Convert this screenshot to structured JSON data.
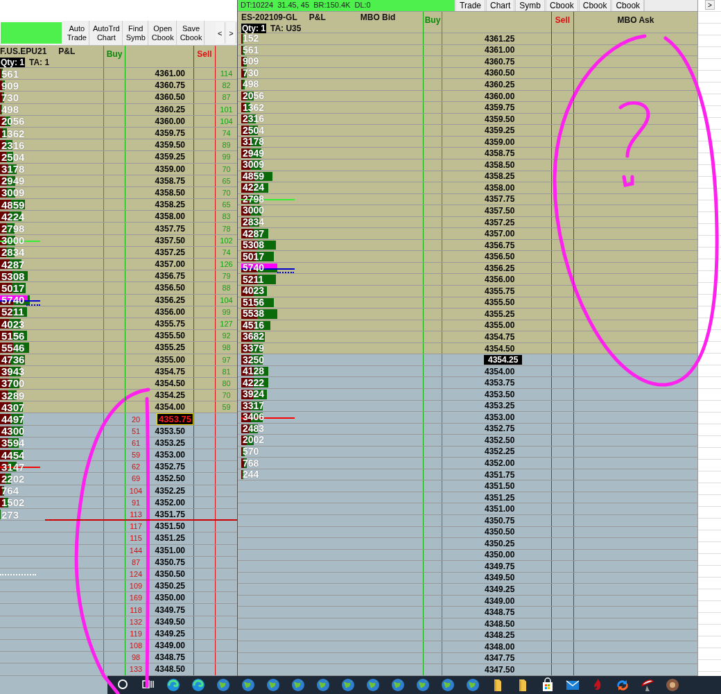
{
  "left_window": {
    "toolbar": {
      "buttons": [
        {
          "label": "Auto Trade"
        },
        {
          "label": "AutoTrd Chart"
        },
        {
          "label": "Find Symb"
        },
        {
          "label": "Open Cbook"
        },
        {
          "label": "Save Cbook"
        }
      ],
      "scroll_buttons": [
        "<",
        ">"
      ]
    },
    "header": {
      "symbol": "F.US.EPU21",
      "columns": [
        "P&L",
        "Buy",
        "Sell"
      ],
      "qty": "Qty: 1",
      "ta": "TA: 1"
    },
    "rows": [
      {
        "price": "4361.00",
        "pl": "561",
        "level": 0.03,
        "ask_qty": "114",
        "above_market": true,
        "current": false
      },
      {
        "price": "4360.75",
        "pl": "909",
        "level": 0.05,
        "ask_qty": "82",
        "above_market": true,
        "current": false
      },
      {
        "price": "4360.50",
        "pl": "730",
        "level": 0.04,
        "ask_qty": "87",
        "above_market": true,
        "current": false
      },
      {
        "price": "4360.25",
        "pl": "498",
        "level": 0.02,
        "ask_qty": "101",
        "above_market": true,
        "current": false
      },
      {
        "price": "4360.00",
        "pl": "2056",
        "level": 0.1,
        "ask_qty": "104",
        "above_market": true,
        "current": false
      },
      {
        "price": "4359.75",
        "pl": "1362",
        "level": 0.07,
        "ask_qty": "74",
        "above_market": true,
        "current": false
      },
      {
        "price": "4359.50",
        "pl": "2316",
        "level": 0.12,
        "ask_qty": "89",
        "above_market": true,
        "current": false
      },
      {
        "price": "4359.25",
        "pl": "2504",
        "level": 0.13,
        "ask_qty": "99",
        "above_market": true,
        "current": false
      },
      {
        "price": "4359.00",
        "pl": "3178",
        "level": 0.16,
        "ask_qty": "70",
        "above_market": true,
        "current": false
      },
      {
        "price": "4358.75",
        "pl": "2949",
        "level": 0.15,
        "ask_qty": "65",
        "above_market": true,
        "current": false
      },
      {
        "price": "4358.50",
        "pl": "3009",
        "level": 0.15,
        "ask_qty": "70",
        "above_market": true,
        "current": false
      },
      {
        "price": "4358.25",
        "pl": "4859",
        "level": 0.24,
        "ask_qty": "65",
        "above_market": true,
        "current": false
      },
      {
        "price": "4358.00",
        "pl": "4224",
        "level": 0.21,
        "ask_qty": "83",
        "above_market": true,
        "current": false
      },
      {
        "price": "4357.75",
        "pl": "2798",
        "level": 0.14,
        "ask_qty": "78",
        "above_market": true,
        "current": false
      },
      {
        "price": "4357.50",
        "pl": "3000",
        "level": 0.15,
        "ask_qty": "102",
        "above_market": true,
        "current": false,
        "markers": [
          {
            "kind": "line",
            "color": "#33ee33"
          }
        ]
      },
      {
        "price": "4357.25",
        "pl": "2834",
        "level": 0.14,
        "ask_qty": "74",
        "above_market": true,
        "current": false
      },
      {
        "price": "4357.00",
        "pl": "4287",
        "level": 0.21,
        "ask_qty": "126",
        "above_market": true,
        "current": false
      },
      {
        "price": "4356.75",
        "pl": "5308",
        "level": 0.27,
        "ask_qty": "79",
        "above_market": true,
        "current": false
      },
      {
        "price": "4356.50",
        "pl": "5017",
        "level": 0.25,
        "ask_qty": "88",
        "above_market": true,
        "current": false
      },
      {
        "price": "4356.25",
        "pl": "5740",
        "level": 0.29,
        "ask_qty": "104",
        "above_market": true,
        "current": false,
        "markers": [
          {
            "kind": "bar",
            "color": "#ff00ff"
          },
          {
            "kind": "line",
            "color": "#0000cc"
          },
          {
            "kind": "short-dotted",
            "color": "#0000cc"
          }
        ]
      },
      {
        "price": "4356.00",
        "pl": "5211",
        "level": 0.26,
        "ask_qty": "99",
        "above_market": true,
        "current": false
      },
      {
        "price": "4355.75",
        "pl": "4023",
        "level": 0.2,
        "ask_qty": "127",
        "above_market": true,
        "current": false
      },
      {
        "price": "4355.50",
        "pl": "5156",
        "level": 0.26,
        "ask_qty": "92",
        "above_market": true,
        "current": false
      },
      {
        "price": "4355.25",
        "pl": "5546",
        "level": 0.28,
        "ask_qty": "98",
        "above_market": true,
        "current": false
      },
      {
        "price": "4355.00",
        "pl": "4736",
        "level": 0.24,
        "ask_qty": "97",
        "above_market": true,
        "current": false
      },
      {
        "price": "4354.75",
        "pl": "3943",
        "level": 0.2,
        "ask_qty": "81",
        "above_market": true,
        "current": false
      },
      {
        "price": "4354.50",
        "pl": "3700",
        "level": 0.19,
        "ask_qty": "80",
        "above_market": true,
        "current": false
      },
      {
        "price": "4354.25",
        "pl": "3289",
        "level": 0.16,
        "ask_qty": "70",
        "above_market": true,
        "current": false
      },
      {
        "price": "4354.00",
        "pl": "4307",
        "level": 0.22,
        "ask_qty": "59",
        "above_market": true,
        "current": false
      },
      {
        "price": "4353.75",
        "pl": "4497",
        "level": 0.22,
        "bid_qty": "20",
        "above_market": false,
        "current": true
      },
      {
        "price": "4353.50",
        "pl": "4300",
        "level": 0.22,
        "bid_qty": "51",
        "above_market": false,
        "current": false
      },
      {
        "price": "4353.25",
        "pl": "3594",
        "level": 0.18,
        "bid_qty": "61",
        "above_market": false,
        "current": false
      },
      {
        "price": "4353.00",
        "pl": "4454",
        "level": 0.22,
        "bid_qty": "59",
        "above_market": false,
        "current": false
      },
      {
        "price": "4352.75",
        "pl": "3147",
        "level": 0.16,
        "bid_qty": "62",
        "above_market": false,
        "current": false,
        "markers": [
          {
            "kind": "line",
            "color": "#ff0000"
          }
        ]
      },
      {
        "price": "4352.50",
        "pl": "2202",
        "level": 0.11,
        "bid_qty": "69",
        "above_market": false,
        "current": false
      },
      {
        "price": "4352.25",
        "pl": "764",
        "level": 0.04,
        "bid_qty": "104",
        "above_market": false,
        "current": false
      },
      {
        "price": "4352.00",
        "pl": "1502",
        "level": 0.08,
        "bid_qty": "91",
        "above_market": false,
        "current": false
      },
      {
        "price": "4351.75",
        "pl": "273",
        "level": 0.01,
        "bid_qty": "113",
        "above_market": false,
        "current": false
      },
      {
        "price": "4351.50",
        "bid_qty": "117",
        "above_market": false,
        "current": false,
        "markers": [
          {
            "kind": "long",
            "color": "#cc0000"
          }
        ]
      },
      {
        "price": "4351.25",
        "bid_qty": "115",
        "above_market": false,
        "current": false
      },
      {
        "price": "4351.00",
        "bid_qty": "144",
        "above_market": false,
        "current": false
      },
      {
        "price": "4350.75",
        "bid_qty": "87",
        "above_market": false,
        "current": false
      },
      {
        "price": "4350.50",
        "bid_qty": "124",
        "above_market": false,
        "current": false,
        "markers": [
          {
            "kind": "dotted",
            "color": "#ffffff"
          }
        ]
      },
      {
        "price": "4350.25",
        "bid_qty": "109",
        "above_market": false,
        "current": false
      },
      {
        "price": "4350.00",
        "bid_qty": "169",
        "above_market": false,
        "current": false
      },
      {
        "price": "4349.75",
        "bid_qty": "118",
        "above_market": false,
        "current": false
      },
      {
        "price": "4349.50",
        "bid_qty": "132",
        "above_market": false,
        "current": false
      },
      {
        "price": "4349.25",
        "bid_qty": "119",
        "above_market": false,
        "current": false
      },
      {
        "price": "4349.00",
        "bid_qty": "108",
        "above_market": false,
        "current": false
      },
      {
        "price": "4348.75",
        "bid_qty": "98",
        "above_market": false,
        "current": false
      },
      {
        "price": "4348.50",
        "bid_qty": "133",
        "above_market": false,
        "current": false
      }
    ]
  },
  "right_window": {
    "status_text": "DT:10224  31.45, 45  BR:150.4K  DL:0",
    "toolbar": {
      "buttons": [
        {
          "label": "Trade"
        },
        {
          "label": "Chart"
        },
        {
          "label": "Symb"
        },
        {
          "label": "Cbook"
        },
        {
          "label": "Cbook"
        },
        {
          "label": "Cbook"
        }
      ]
    },
    "header": {
      "symbol": "ES-202109-GL",
      "columns": [
        "P&L",
        "MBO Bid",
        "Buy",
        "Sell",
        "MBO Ask"
      ],
      "qty": "Qty: 1",
      "ta": "TA: U35"
    },
    "rows": [
      {
        "price": "4361.25",
        "pl": "152",
        "level": 0.01,
        "above_market": true,
        "current": false
      },
      {
        "price": "4361.00",
        "pl": "561",
        "level": 0.02,
        "above_market": true,
        "current": false
      },
      {
        "price": "4360.75",
        "pl": "909",
        "level": 0.03,
        "above_market": true,
        "current": false
      },
      {
        "price": "4360.50",
        "pl": "730",
        "level": 0.03,
        "above_market": true,
        "current": false
      },
      {
        "price": "4360.25",
        "pl": "498",
        "level": 0.02,
        "above_market": true,
        "current": false
      },
      {
        "price": "4360.00",
        "pl": "2056",
        "level": 0.07,
        "above_market": true,
        "current": false
      },
      {
        "price": "4359.75",
        "pl": "1362",
        "level": 0.05,
        "above_market": true,
        "current": false
      },
      {
        "price": "4359.50",
        "pl": "2316",
        "level": 0.08,
        "above_market": true,
        "current": false
      },
      {
        "price": "4359.25",
        "pl": "2504",
        "level": 0.09,
        "above_market": true,
        "current": false
      },
      {
        "price": "4359.00",
        "pl": "3178",
        "level": 0.11,
        "above_market": true,
        "current": false
      },
      {
        "price": "4358.75",
        "pl": "2949",
        "level": 0.11,
        "above_market": true,
        "current": false
      },
      {
        "price": "4358.50",
        "pl": "3009",
        "level": 0.11,
        "above_market": true,
        "current": false
      },
      {
        "price": "4358.25",
        "pl": "4859",
        "level": 0.17,
        "above_market": true,
        "current": false
      },
      {
        "price": "4358.00",
        "pl": "4224",
        "level": 0.15,
        "above_market": true,
        "current": false
      },
      {
        "price": "4357.75",
        "pl": "2798",
        "level": 0.1,
        "above_market": true,
        "current": false,
        "markers": [
          {
            "kind": "line",
            "color": "#33ee33"
          }
        ]
      },
      {
        "price": "4357.50",
        "pl": "3000",
        "level": 0.11,
        "above_market": true,
        "current": false
      },
      {
        "price": "4357.25",
        "pl": "2834",
        "level": 0.1,
        "above_market": true,
        "current": false
      },
      {
        "price": "4357.00",
        "pl": "4287",
        "level": 0.15,
        "above_market": true,
        "current": false
      },
      {
        "price": "4356.75",
        "pl": "5308",
        "level": 0.19,
        "above_market": true,
        "current": false
      },
      {
        "price": "4356.50",
        "pl": "5017",
        "level": 0.18,
        "above_market": true,
        "current": false
      },
      {
        "price": "4356.25",
        "pl": "5740",
        "level": 0.2,
        "above_market": true,
        "current": false,
        "markers": [
          {
            "kind": "bar",
            "color": "#ff00ff"
          },
          {
            "kind": "line",
            "color": "#0000cc"
          },
          {
            "kind": "short-dotted",
            "color": "#0000cc"
          }
        ]
      },
      {
        "price": "4356.00",
        "pl": "5211",
        "level": 0.19,
        "above_market": true,
        "current": false
      },
      {
        "price": "4355.75",
        "pl": "4023",
        "level": 0.14,
        "above_market": true,
        "current": false
      },
      {
        "price": "4355.50",
        "pl": "5156",
        "level": 0.18,
        "above_market": true,
        "current": false
      },
      {
        "price": "4355.25",
        "pl": "5538",
        "level": 0.2,
        "above_market": true,
        "current": false
      },
      {
        "price": "4355.00",
        "pl": "4516",
        "level": 0.16,
        "above_market": true,
        "current": false
      },
      {
        "price": "4354.75",
        "pl": "3682",
        "level": 0.13,
        "above_market": true,
        "current": false
      },
      {
        "price": "4354.50",
        "pl": "3379",
        "level": 0.12,
        "above_market": true,
        "current": false
      },
      {
        "price": "4354.25",
        "pl": "3250",
        "level": 0.12,
        "above_market": false,
        "current": true
      },
      {
        "price": "4354.00",
        "pl": "4128",
        "level": 0.15,
        "above_market": false,
        "current": false
      },
      {
        "price": "4353.75",
        "pl": "4222",
        "level": 0.15,
        "above_market": false,
        "current": false
      },
      {
        "price": "4353.50",
        "pl": "3924",
        "level": 0.14,
        "above_market": false,
        "current": false
      },
      {
        "price": "4353.25",
        "pl": "3317",
        "level": 0.12,
        "above_market": false,
        "current": false
      },
      {
        "price": "4353.00",
        "pl": "3406",
        "level": 0.12,
        "above_market": false,
        "current": false,
        "markers": [
          {
            "kind": "line",
            "color": "#ff0000"
          }
        ]
      },
      {
        "price": "4352.75",
        "pl": "2483",
        "level": 0.09,
        "above_market": false,
        "current": false
      },
      {
        "price": "4352.50",
        "pl": "2002",
        "level": 0.07,
        "above_market": false,
        "current": false
      },
      {
        "price": "4352.25",
        "pl": "570",
        "level": 0.02,
        "above_market": false,
        "current": false
      },
      {
        "price": "4352.00",
        "pl": "768",
        "level": 0.03,
        "above_market": false,
        "current": false
      },
      {
        "price": "4351.75",
        "pl": "244",
        "level": 0.01,
        "above_market": false,
        "current": false
      },
      {
        "price": "4351.50",
        "above_market": false,
        "current": false
      },
      {
        "price": "4351.25",
        "above_market": false,
        "current": false
      },
      {
        "price": "4351.00",
        "above_market": false,
        "current": false
      },
      {
        "price": "4350.75",
        "above_market": false,
        "current": false
      },
      {
        "price": "4350.50",
        "above_market": false,
        "current": false
      },
      {
        "price": "4350.25",
        "above_market": false,
        "current": false
      },
      {
        "price": "4350.00",
        "above_market": false,
        "current": false
      },
      {
        "price": "4349.75",
        "above_market": false,
        "current": false
      },
      {
        "price": "4349.50",
        "above_market": false,
        "current": false
      },
      {
        "price": "4349.25",
        "above_market": false,
        "current": false
      },
      {
        "price": "4349.00",
        "above_market": false,
        "current": false
      },
      {
        "price": "4348.75",
        "above_market": false,
        "current": false
      },
      {
        "price": "4348.50",
        "above_market": false,
        "current": false
      },
      {
        "price": "4348.25",
        "above_market": false,
        "current": false
      },
      {
        "price": "4348.00",
        "above_market": false,
        "current": false
      },
      {
        "price": "4347.75",
        "above_market": false,
        "current": false
      },
      {
        "price": "4347.50",
        "above_market": false,
        "current": false
      }
    ]
  },
  "right_edge": {
    "scroll_button": ">"
  },
  "taskbar": {
    "icons": [
      {
        "kind": "search"
      },
      {
        "kind": "task-view"
      },
      {
        "kind": "swirl"
      },
      {
        "kind": "swirl"
      },
      {
        "kind": "globe"
      },
      {
        "kind": "globe"
      },
      {
        "kind": "globe"
      },
      {
        "kind": "globe"
      },
      {
        "kind": "globe"
      },
      {
        "kind": "globe"
      },
      {
        "kind": "globe"
      },
      {
        "kind": "globe"
      },
      {
        "kind": "globe"
      },
      {
        "kind": "globe"
      },
      {
        "kind": "globe"
      },
      {
        "kind": "folder"
      },
      {
        "kind": "folder"
      },
      {
        "kind": "store"
      },
      {
        "kind": "mail"
      },
      {
        "kind": "flame"
      },
      {
        "kind": "arrows"
      },
      {
        "kind": "dish"
      },
      {
        "kind": "app"
      }
    ]
  },
  "annotations": [
    {
      "kind": "left-loop"
    },
    {
      "kind": "right-loop"
    },
    {
      "kind": "question-mark"
    }
  ]
}
